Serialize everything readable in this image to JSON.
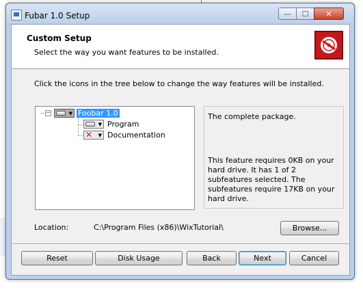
{
  "window": {
    "title": "Fubar 1.0 Setup",
    "controls": {
      "minimize": "—",
      "maximize": "☐",
      "close": "✕"
    }
  },
  "banner": {
    "title": "Custom Setup",
    "subtitle": "Select the way you want features to be installed.",
    "logo_color": "#c8161a"
  },
  "instruction": "Click the icons in the tree below to change the way features will be installed.",
  "tree": {
    "root": {
      "expander": "−",
      "icon": "drive-icon",
      "label": "Foobar 1.0",
      "selected": true
    },
    "children": [
      {
        "icon": "drive-icon",
        "label": "Program"
      },
      {
        "icon": "x-mark-icon",
        "label": "Documentation"
      }
    ]
  },
  "description": {
    "main": "The complete package.",
    "requirements": "This feature requires 0KB on your hard drive. It has 1 of 2 subfeatures selected. The subfeatures require 17KB on your hard drive."
  },
  "location": {
    "label": "Location:",
    "path": "C:\\Program Files (x86)\\WixTutorial\\"
  },
  "buttons": {
    "browse": "Browse...",
    "reset": "Reset",
    "disk_usage": "Disk Usage",
    "back": "Back",
    "next": "Next",
    "cancel": "Cancel"
  },
  "colors": {
    "selection": "#3399ff",
    "frame": "#bcd0ea"
  }
}
